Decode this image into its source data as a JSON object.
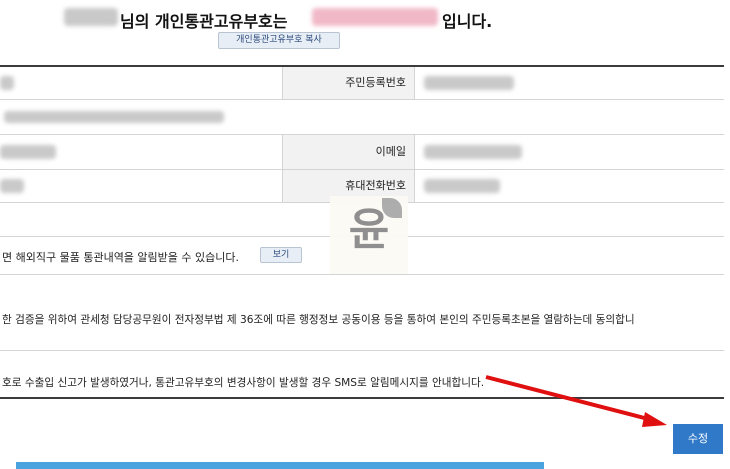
{
  "header": {
    "title_middle": "님의 개인통관고유부호는",
    "title_end": "입니다.",
    "copy_button": "개인통관고유부호 복사"
  },
  "form": {
    "resident_number_label": "주민등록번호",
    "email_label": "이메일",
    "mobile_label": "휴대전화번호",
    "overseas_notice": "면 해외직구 물품 통관내역을 알림받을 수 있습니다.",
    "view_button": "보기",
    "consent_text": "한 검증을 위하여 관세청 담당공무원이 전자정부법 제 36조에 따른 행정정보 공동이용 등을 통하여 본인의 주민등록초본을 열람하는데 동의합니",
    "sms_text": "호로 수출입 신고가 발생하였거나, 통관고유부호의 변경사항이 발생할 경우 SMS로 알림메시지를 안내합니다."
  },
  "watermark": {
    "text": "윤"
  },
  "actions": {
    "submit_button": "수정"
  },
  "colors": {
    "accent": "#2f79c8",
    "arrow": "#e01010"
  }
}
